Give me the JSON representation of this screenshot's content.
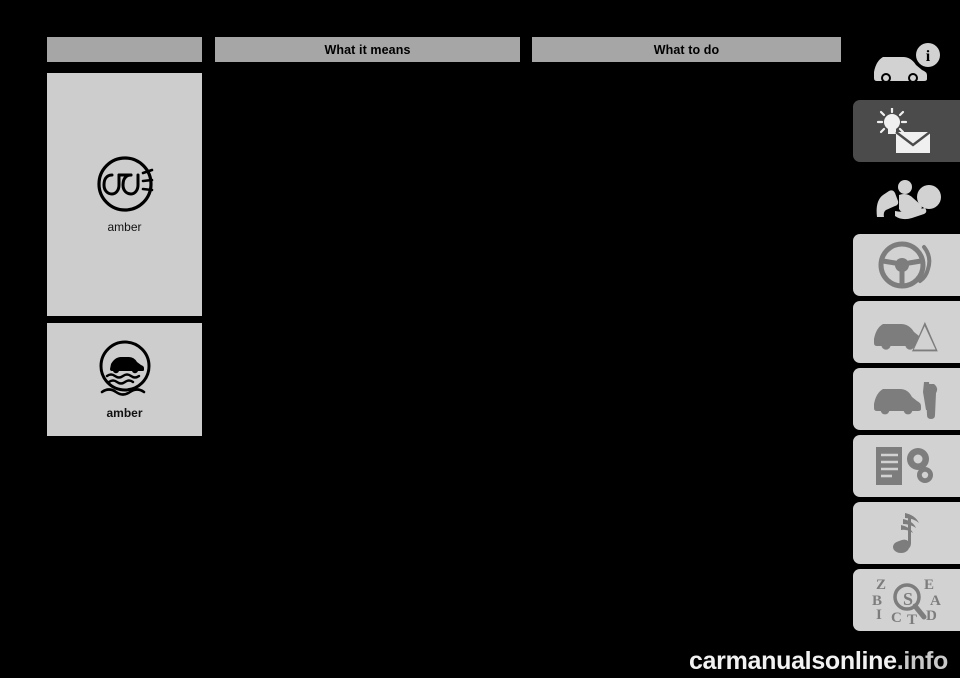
{
  "page": {
    "background_color": "#000000",
    "watermark": "carmanualsonline",
    "watermark_suffix": ".info"
  },
  "table": {
    "headers": {
      "symbol": "",
      "what_it_means": "What it means",
      "what_to_do": "What to do"
    },
    "rows": [
      {
        "icon_name": "headlight-on-warning-icon",
        "color_label": "amber",
        "what_it_means": "",
        "what_to_do": ""
      },
      {
        "icon_name": "slippery-road-traction-control-icon",
        "color_label": "amber",
        "what_it_means": "",
        "what_to_do": ""
      }
    ]
  },
  "rail": {
    "tabs": [
      {
        "name": "vehicle-information-tab",
        "icon": "car-info-icon",
        "style": "black"
      },
      {
        "name": "lights-and-messages-tab",
        "icon": "lamp-envelope-icon",
        "style": "dark"
      },
      {
        "name": "safety-airbag-tab",
        "icon": "airbag-occupant-icon",
        "style": "black"
      },
      {
        "name": "driving-tab",
        "icon": "steering-wheel-icon",
        "style": "light"
      },
      {
        "name": "emergency-tab",
        "icon": "car-warning-triangle-icon",
        "style": "light"
      },
      {
        "name": "maintenance-tab",
        "icon": "car-wrench-icon",
        "style": "light"
      },
      {
        "name": "specifications-tab",
        "icon": "document-gear-icon",
        "style": "light"
      },
      {
        "name": "multimedia-tab",
        "icon": "music-note-icon",
        "style": "light"
      },
      {
        "name": "index-tab",
        "icon": "alphabetical-index-icon",
        "style": "light"
      }
    ]
  }
}
